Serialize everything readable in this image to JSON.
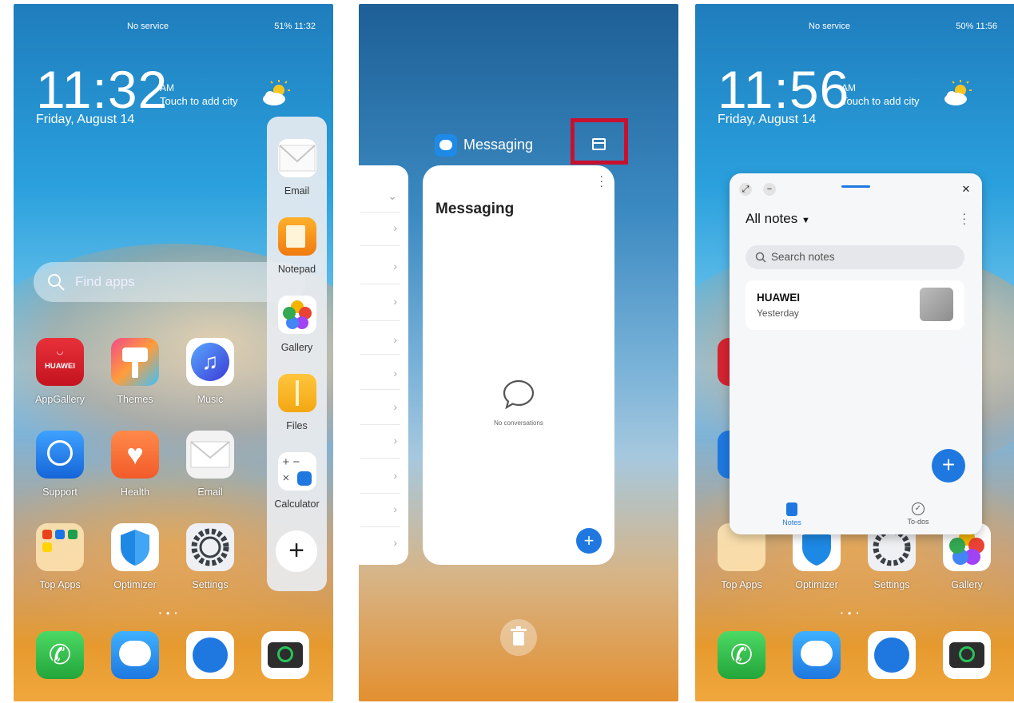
{
  "panel1": {
    "status_left": "No service",
    "status_right": "51% 11:32",
    "clock_time": "11:32",
    "clock_ampm": "AM",
    "city_hint": "Touch to add city",
    "date": "Friday, August 14",
    "search_placeholder": "Find apps",
    "apps_row1": [
      "AppGallery",
      "Themes",
      "Music"
    ],
    "apps_row2": [
      "Support",
      "Health",
      "Email"
    ],
    "apps_row3": [
      "Top Apps",
      "Optimizer",
      "Settings"
    ],
    "huawei_logo_text": "HUAWEI",
    "sidebar": [
      "Email",
      "Notepad",
      "Gallery",
      "Files",
      "Calculator"
    ],
    "sidebar_add": "+"
  },
  "panel2": {
    "app_name": "Messaging",
    "card_title": "Messaging",
    "empty_text": "No conversations",
    "fab": "+"
  },
  "panel3": {
    "status_left": "No service",
    "status_right": "50% 11:56",
    "clock_time": "11:56",
    "clock_ampm": "AM",
    "city_hint": "Touch to add city",
    "date": "Friday, August 14",
    "notes_header": "All notes",
    "search_placeholder": "Search notes",
    "note_title": "HUAWEI",
    "note_date": "Yesterday",
    "fab": "+",
    "tab_notes": "Notes",
    "tab_todos": "To-dos",
    "apps_row3": [
      "Top Apps",
      "Optimizer",
      "Settings",
      "Gallery"
    ]
  },
  "colors": {
    "accent": "#1e78e0",
    "highlight": "#c8102e"
  }
}
